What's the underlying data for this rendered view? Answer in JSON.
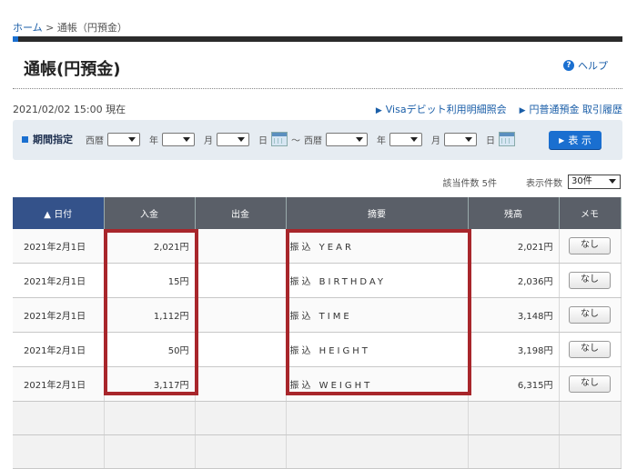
{
  "breadcrumb": {
    "home": "ホーム",
    "sep": ">",
    "current": "通帳（円預金）"
  },
  "page_title": "通帳(円預金)",
  "help_label": "ヘルプ",
  "datetime": "2021/02/02 15:00 現在",
  "links": {
    "visa": "Visaデビット利用明細照会",
    "history": "円普通預金 取引履歴"
  },
  "period": {
    "label": "期間指定",
    "era1": "西暦",
    "year": "年",
    "month": "月",
    "day": "日",
    "tilde": "～",
    "era2": "西暦",
    "show_button": "表 示"
  },
  "count": {
    "matched": "該当件数 5件",
    "display_label": "表示件数",
    "display_value": "30件"
  },
  "table": {
    "headers": {
      "date": "日付",
      "deposit": "入金",
      "withdrawal": "出金",
      "description": "摘要",
      "balance": "残高",
      "memo": "メモ"
    },
    "rows": [
      {
        "date": "2021年2月1日",
        "deposit": "2,021円",
        "withdrawal": "",
        "description": "振込 YEAR",
        "balance": "2,021円",
        "memo": "なし"
      },
      {
        "date": "2021年2月1日",
        "deposit": "15円",
        "withdrawal": "",
        "description": "振込 BIRTHDAY",
        "balance": "2,036円",
        "memo": "なし"
      },
      {
        "date": "2021年2月1日",
        "deposit": "1,112円",
        "withdrawal": "",
        "description": "振込 TIME",
        "balance": "3,148円",
        "memo": "なし"
      },
      {
        "date": "2021年2月1日",
        "deposit": "50円",
        "withdrawal": "",
        "description": "振込 HEIGHT",
        "balance": "3,198円",
        "memo": "なし"
      },
      {
        "date": "2021年2月1日",
        "deposit": "3,117円",
        "withdrawal": "",
        "description": "振込 WEIGHT",
        "balance": "6,315円",
        "memo": "なし"
      }
    ]
  },
  "colors": {
    "accent": "#1a6fd0",
    "highlight": "#a8262b",
    "header_dark": "#34528a",
    "header": "#5a5f68"
  }
}
